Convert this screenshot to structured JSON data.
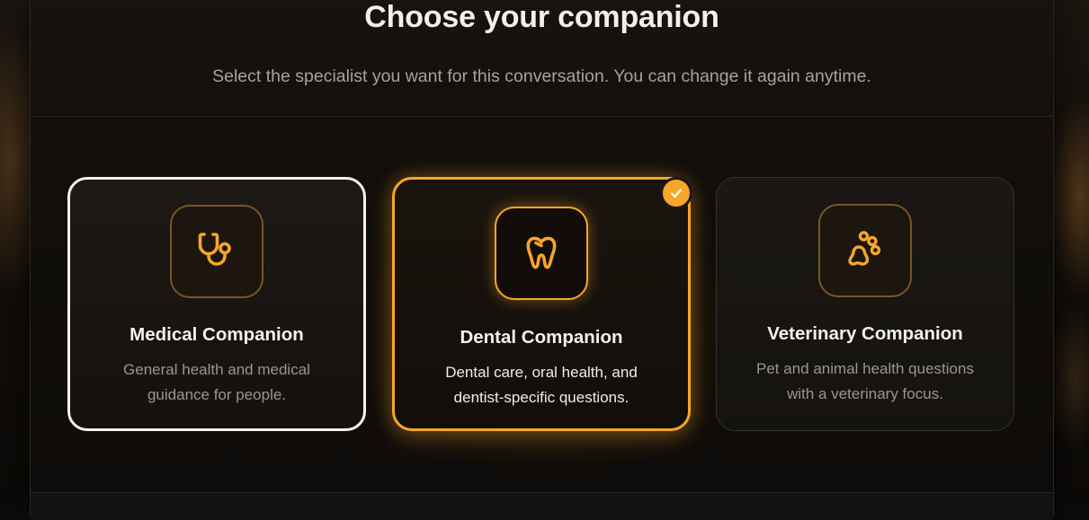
{
  "dialog": {
    "title": "Choose your companion",
    "subtitle": "Select the specialist you want for this conversation. You can change it again anytime."
  },
  "companions": [
    {
      "id": "medical",
      "title": "Medical Companion",
      "description": "General health and medical guidance for people.",
      "icon": "stethoscope-icon",
      "state": "focused"
    },
    {
      "id": "dental",
      "title": "Dental Companion",
      "description": "Dental care, oral health, and dentist-specific questions.",
      "icon": "tooth-icon",
      "state": "selected"
    },
    {
      "id": "veterinary",
      "title": "Veterinary Companion",
      "description": "Pet and animal health questions with a veterinary focus.",
      "icon": "paw-icon",
      "state": "default"
    }
  ],
  "selected_badge_icon": "checkmark-icon",
  "colors": {
    "accent": "#f7a62a",
    "focus_border": "#f5f2ee",
    "title_text": "#f4efe9",
    "muted_text": "#a9a29a",
    "background": "#110e0b"
  }
}
